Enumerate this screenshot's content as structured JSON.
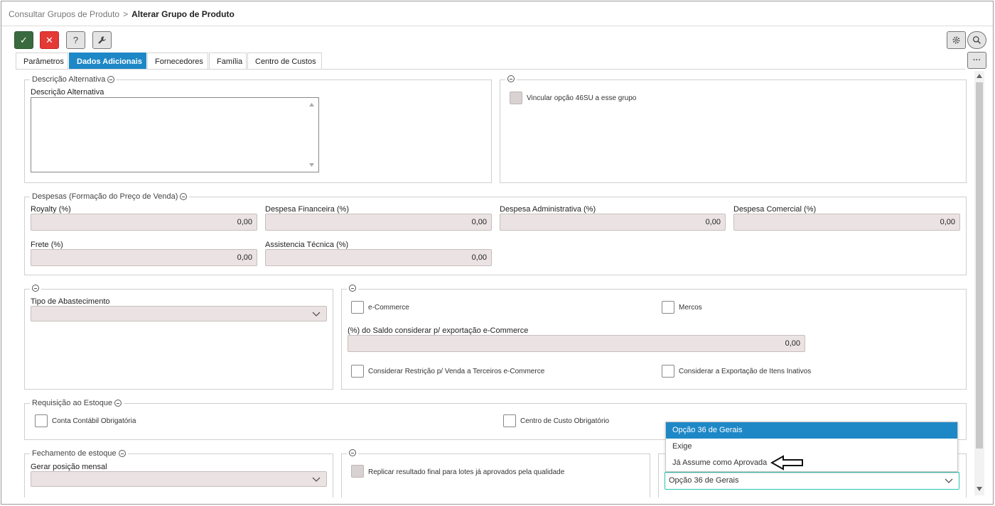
{
  "breadcrumb": {
    "parent": "Consultar Grupos de Produto",
    "separator": ">",
    "current": "Alterar Grupo de Produto"
  },
  "toolbar": {
    "confirm_icon": "✓",
    "cancel_icon": "✕",
    "help_icon": "?",
    "tools_icon": "wrench-icon",
    "settings_icon": "gear-icon",
    "search_icon": "search-icon",
    "more_icon": "···"
  },
  "tabs": [
    "Parâmetros",
    "Dados Adicionais",
    "Fornecedores",
    "Família",
    "Centro de Custos"
  ],
  "active_tab": "Dados Adicionais",
  "desc_section": {
    "legend": "Descrição Alternativa",
    "field_label": "Descrição Alternativa",
    "value": ""
  },
  "option_section": {
    "checkbox_label": "Vincular opção 46SU a esse grupo",
    "checked": false
  },
  "despesas": {
    "legend": "Despesas (Formação do Preço de Venda)",
    "fields": [
      {
        "label": "Royalty (%)",
        "value": "0,00"
      },
      {
        "label": "Despesa Financeira (%)",
        "value": "0,00"
      },
      {
        "label": "Despesa Administrativa (%)",
        "value": "0,00"
      },
      {
        "label": "Despesa Comercial (%)",
        "value": "0,00"
      },
      {
        "label": "Frete (%)",
        "value": "0,00"
      },
      {
        "label": "Assistencia Técnica (%)",
        "value": "0,00"
      }
    ]
  },
  "abastecimento": {
    "label": "Tipo de Abastecimento",
    "value": ""
  },
  "ecommerce": {
    "ecommerce_label": "e-Commerce",
    "mercos_label": "Mercos",
    "saldo_label": "(%) do Saldo considerar p/ exportação e-Commerce",
    "saldo_value": "0,00",
    "restricao_label": "Considerar Restrição p/ Venda a Terceiros e-Commerce",
    "inativos_label": "Considerar a Exportação de Itens Inativos"
  },
  "requisicao": {
    "legend": "Requisição ao Estoque",
    "conta_label": "Conta Contábil Obrigatória",
    "centro_label": "Centro de Custo Obrigatório"
  },
  "fechamento": {
    "legend": "Fechamento de estoque",
    "label": "Gerar posição mensal",
    "value": ""
  },
  "replicar": {
    "label": "Replicar resultado final para lotes já aprovados pela qualidade"
  },
  "dropdown": {
    "value": "Opção 36 de Gerais",
    "options": [
      "Opção 36 de Gerais",
      "Exige",
      "Já Assume como Aprovada"
    ],
    "highlighted": "Opção 36 de Gerais"
  }
}
